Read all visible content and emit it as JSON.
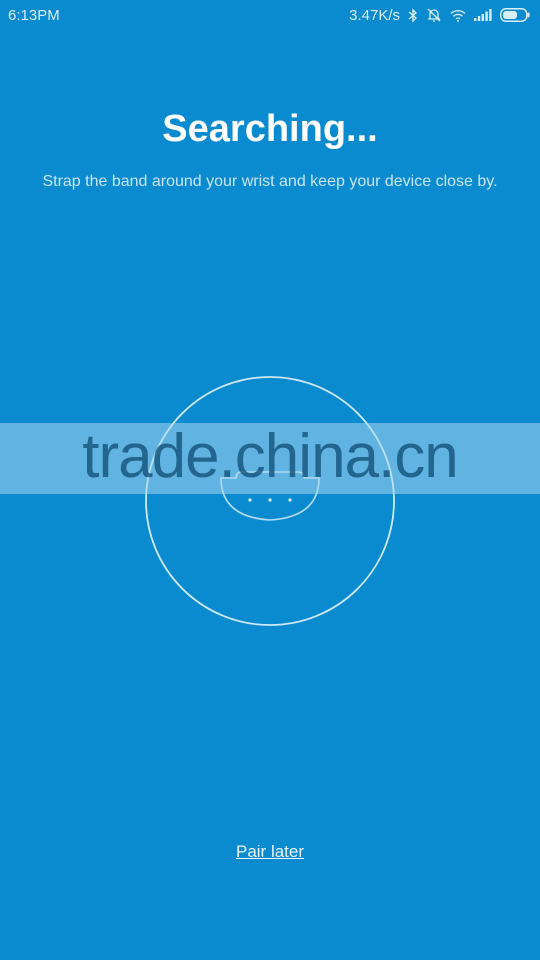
{
  "status_bar": {
    "time": "6:13PM",
    "network_speed": "3.47K/s",
    "icons": [
      "bluetooth-icon",
      "alarm-off-icon",
      "wifi-icon",
      "signal-icon",
      "battery-icon"
    ]
  },
  "main": {
    "title": "Searching...",
    "subtitle": "Strap the band around your wrist and keep your device close by.",
    "pair_later_label": "Pair later"
  },
  "watermark": {
    "text": "trade.china.cn"
  },
  "colors": {
    "background": "#0a8bd0",
    "text": "#ffffff"
  }
}
